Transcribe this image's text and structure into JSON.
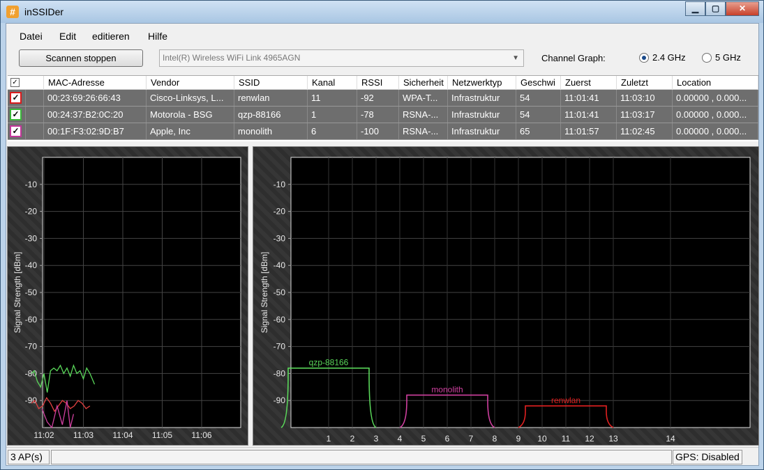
{
  "window": {
    "title": "inSSIDer",
    "app_icon": "#",
    "controls": {
      "minimize": "▁",
      "maximize": "▢",
      "close": "✕"
    }
  },
  "menu": [
    {
      "label": "Datei",
      "accel": "D"
    },
    {
      "label": "Edit",
      "accel": "E"
    },
    {
      "label": "editieren",
      "accel": "e"
    },
    {
      "label": "Hilfe",
      "accel": "H"
    }
  ],
  "toolbar": {
    "scan_button": "Scannen stoppen",
    "adapter": "Intel(R) Wireless WiFi Link 4965AGN",
    "channel_graph_label": "Channel Graph:",
    "band_24": "2.4 GHz",
    "band_5": "5 GHz",
    "selected_band": "2.4 GHz"
  },
  "table": {
    "columns": [
      "MAC-Adresse",
      "Vendor",
      "SSID",
      "Kanal",
      "RSSI",
      "Sicherheit",
      "Netzwerktyp",
      "Geschwi",
      "Zuerst",
      "Zuletzt",
      "Location"
    ],
    "header_check_glyph": "✓",
    "row_check_glyph": "✓",
    "rows": [
      {
        "color": "#d81c1c",
        "mac": "00:23:69:26:66:43",
        "vendor": "Cisco-Linksys, L...",
        "ssid": "renwlan",
        "kanal": "11",
        "rssi": "-92",
        "security": "WPA-T...",
        "type": "Infrastruktur",
        "speed": "54",
        "first": "11:01:41",
        "last": "11:03:10",
        "location": "0.00000 , 0.000..."
      },
      {
        "color": "#3ab83a",
        "mac": "00:24:37:B2:0C:20",
        "vendor": "Motorola - BSG",
        "ssid": "qzp-88166",
        "kanal": "1",
        "rssi": "-78",
        "security": "RSNA-...",
        "type": "Infrastruktur",
        "speed": "54",
        "first": "11:01:41",
        "last": "11:03:17",
        "location": "0.00000 , 0.000..."
      },
      {
        "color": "#c2379a",
        "mac": "00:1F:F3:02:9D:B7",
        "vendor": "Apple, Inc",
        "ssid": "monolith",
        "kanal": "6",
        "rssi": "-100",
        "security": "RSNA-...",
        "type": "Infrastruktur",
        "speed": "65",
        "first": "11:01:57",
        "last": "11:02:45",
        "location": "0.00000 , 0.000..."
      }
    ]
  },
  "chart_data": [
    {
      "type": "line",
      "ylabel": "Signal Strength [dBm]",
      "y_ticks": [
        -10,
        -20,
        -30,
        -40,
        -50,
        -60,
        -70,
        -80,
        -90
      ],
      "ylim": [
        -100,
        0
      ],
      "x_ticks": [
        "11:02",
        "11:03",
        "11:04",
        "11:05",
        "11:06"
      ],
      "grid": true,
      "series": [
        {
          "color": "#5ad85a",
          "x": [
            "11:01:41",
            "11:01:45",
            "11:01:50",
            "11:01:55",
            "11:02:00",
            "11:02:05",
            "11:02:10",
            "11:02:15",
            "11:02:20",
            "11:02:25",
            "11:02:30",
            "11:02:35",
            "11:02:40",
            "11:02:45",
            "11:02:50",
            "11:02:55",
            "11:03:00",
            "11:03:05",
            "11:03:10",
            "11:03:17"
          ],
          "y": [
            -80,
            -79,
            -83,
            -85,
            -80,
            -87,
            -79,
            -78,
            -79,
            -77,
            -80,
            -78,
            -81,
            -77,
            -80,
            -79,
            -82,
            -78,
            -80,
            -84
          ]
        },
        {
          "color": "#e04040",
          "x": [
            "11:01:41",
            "11:01:46",
            "11:01:52",
            "11:01:58",
            "11:02:04",
            "11:02:10",
            "11:02:16",
            "11:02:22",
            "11:02:28",
            "11:02:34",
            "11:02:40",
            "11:02:46",
            "11:02:52",
            "11:02:58",
            "11:03:04",
            "11:03:10"
          ],
          "y": [
            -91,
            -90,
            -93,
            -92,
            -89,
            -91,
            -94,
            -92,
            -90,
            -91,
            -93,
            -92,
            -90,
            -91,
            -93,
            -92
          ]
        },
        {
          "color": "#d040a0",
          "x": [
            "11:01:57",
            "11:02:05",
            "11:02:12",
            "11:02:20",
            "11:02:28",
            "11:02:35",
            "11:02:40",
            "11:02:45"
          ],
          "y": [
            -93,
            -98,
            -100,
            -92,
            -99,
            -90,
            -100,
            -95
          ]
        }
      ]
    },
    {
      "type": "area",
      "ylabel": "Signal Strength [dBm]",
      "y_ticks": [
        -10,
        -20,
        -30,
        -40,
        -50,
        -60,
        -70,
        -80,
        -90
      ],
      "ylim": [
        -100,
        0
      ],
      "x_ticks": [
        1,
        2,
        3,
        4,
        5,
        6,
        7,
        8,
        9,
        10,
        11,
        12,
        13,
        14
      ],
      "grid": true,
      "series": [
        {
          "name": "qzp-88166",
          "channel": 1,
          "rssi": -78,
          "color": "#5ad85a"
        },
        {
          "name": "monolith",
          "channel": 6,
          "rssi": -88,
          "color": "#d040a0"
        },
        {
          "name": "renwlan",
          "channel": 11,
          "rssi": -92,
          "color": "#e02020"
        }
      ]
    }
  ],
  "status": {
    "ap_count": "3 AP(s)",
    "gps": "GPS: Disabled"
  }
}
